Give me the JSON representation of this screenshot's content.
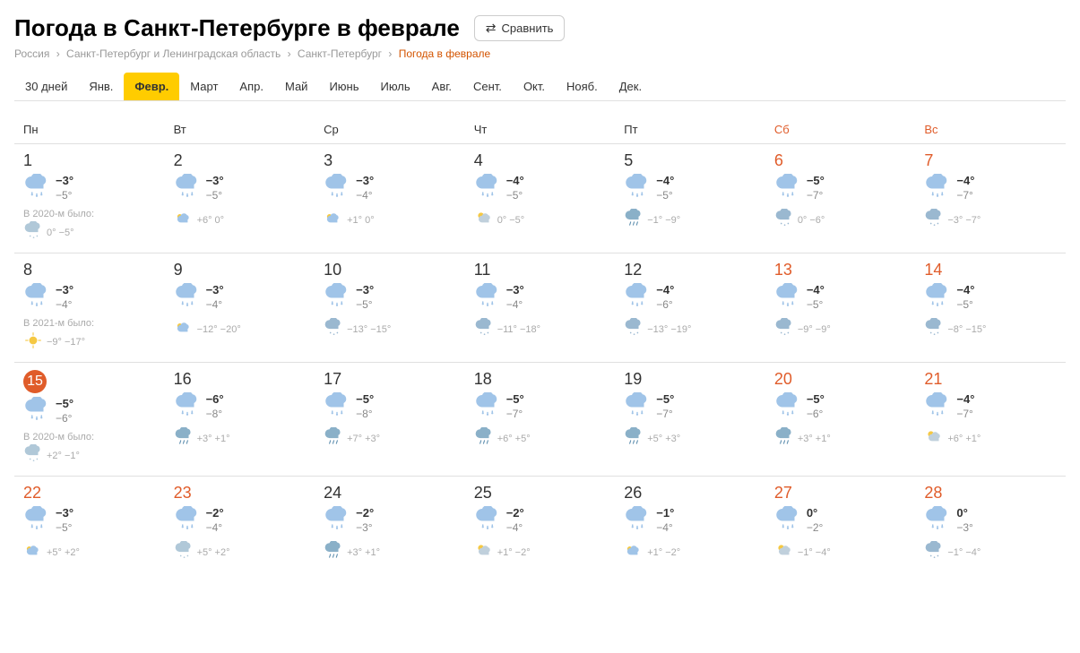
{
  "header": {
    "title": "Погода в Санкт-Петербурге в феврале",
    "compare_label": "Сравнить"
  },
  "breadcrumb": {
    "parts": [
      "Россия",
      "Санкт-Петербург и Ленинградская область",
      "Санкт-Петербург",
      "Погода в феврале"
    ]
  },
  "tabs": [
    {
      "label": "30 дней",
      "active": false
    },
    {
      "label": "Янв.",
      "active": false
    },
    {
      "label": "Февр.",
      "active": true
    },
    {
      "label": "Март",
      "active": false
    },
    {
      "label": "Апр.",
      "active": false
    },
    {
      "label": "Май",
      "active": false
    },
    {
      "label": "Июнь",
      "active": false
    },
    {
      "label": "Июль",
      "active": false
    },
    {
      "label": "Авг.",
      "active": false
    },
    {
      "label": "Сент.",
      "active": false
    },
    {
      "label": "Окт.",
      "active": false
    },
    {
      "label": "Нояб.",
      "active": false
    },
    {
      "label": "Дек.",
      "active": false
    }
  ],
  "weekdays": [
    {
      "label": "Пн",
      "weekend": false
    },
    {
      "label": "Вт",
      "weekend": false
    },
    {
      "label": "Ср",
      "weekend": false
    },
    {
      "label": "Чт",
      "weekend": false
    },
    {
      "label": "Пт",
      "weekend": false
    },
    {
      "label": "Сб",
      "weekend": true
    },
    {
      "label": "Вс",
      "weekend": true
    }
  ],
  "weeks": [
    {
      "days": [
        {
          "num": "1",
          "weekend": false,
          "today": false,
          "high": "−3°",
          "low": "−5°",
          "icon": "cloud-snow",
          "prev_label": "В 2020-м было:",
          "prev_icon": "cloud-snow-light",
          "prev_temps": "0° −5°"
        },
        {
          "num": "2",
          "weekend": false,
          "today": false,
          "high": "−3°",
          "low": "−5°",
          "icon": "cloud-snow",
          "prev_label": "",
          "prev_icon": "cloudy-sun",
          "prev_temps": "+6° 0°"
        },
        {
          "num": "3",
          "weekend": false,
          "today": false,
          "high": "−3°",
          "low": "−4°",
          "icon": "cloud-snow",
          "prev_label": "",
          "prev_icon": "cloudy-sun",
          "prev_temps": "+1° 0°"
        },
        {
          "num": "4",
          "weekend": false,
          "today": false,
          "high": "−4°",
          "low": "−5°",
          "icon": "cloud-snow",
          "prev_label": "",
          "prev_icon": "sun-cloudy",
          "prev_temps": "0° −5°"
        },
        {
          "num": "5",
          "weekend": false,
          "today": false,
          "high": "−4°",
          "low": "−5°",
          "icon": "cloud-snow",
          "prev_label": "",
          "prev_icon": "cloudy-rain",
          "prev_temps": "−1° −9°"
        },
        {
          "num": "6",
          "weekend": true,
          "today": false,
          "high": "−5°",
          "low": "−7°",
          "icon": "cloud-snow",
          "prev_label": "",
          "prev_icon": "cloudy-snow",
          "prev_temps": "0° −6°"
        },
        {
          "num": "7",
          "weekend": true,
          "today": false,
          "high": "−4°",
          "low": "−7°",
          "icon": "cloud-snow",
          "prev_label": "",
          "prev_icon": "cloudy-snow",
          "prev_temps": "−3° −7°"
        }
      ]
    },
    {
      "days": [
        {
          "num": "8",
          "weekend": false,
          "today": false,
          "high": "−3°",
          "low": "−4°",
          "icon": "cloud-snow",
          "prev_label": "В 2021-м было:",
          "prev_icon": "sun",
          "prev_temps": "−9° −17°"
        },
        {
          "num": "9",
          "weekend": false,
          "today": false,
          "high": "−3°",
          "low": "−4°",
          "icon": "cloud-snow",
          "prev_label": "",
          "prev_icon": "cloudy-sun",
          "prev_temps": "−12° −20°"
        },
        {
          "num": "10",
          "weekend": false,
          "today": false,
          "high": "−3°",
          "low": "−5°",
          "icon": "cloud-snow",
          "prev_label": "",
          "prev_icon": "cloudy-snow",
          "prev_temps": "−13° −15°"
        },
        {
          "num": "11",
          "weekend": false,
          "today": false,
          "high": "−3°",
          "low": "−4°",
          "icon": "cloud-snow",
          "prev_label": "",
          "prev_icon": "cloudy-snow",
          "prev_temps": "−11° −18°"
        },
        {
          "num": "12",
          "weekend": false,
          "today": false,
          "high": "−4°",
          "low": "−6°",
          "icon": "cloud-snow",
          "prev_label": "",
          "prev_icon": "cloudy-snow",
          "prev_temps": "−13° −19°"
        },
        {
          "num": "13",
          "weekend": true,
          "today": false,
          "high": "−4°",
          "low": "−5°",
          "icon": "cloud-snow",
          "prev_label": "",
          "prev_icon": "cloudy-snow",
          "prev_temps": "−9° −9°"
        },
        {
          "num": "14",
          "weekend": true,
          "today": false,
          "high": "−4°",
          "low": "−5°",
          "icon": "cloud-snow",
          "prev_label": "",
          "prev_icon": "cloudy-snow",
          "prev_temps": "−8° −15°"
        }
      ]
    },
    {
      "days": [
        {
          "num": "15",
          "weekend": false,
          "today": true,
          "high": "−5°",
          "low": "−6°",
          "icon": "cloud-snow",
          "prev_label": "В 2020-м было:",
          "prev_icon": "cloud-snow-light",
          "prev_temps": "+2° −1°"
        },
        {
          "num": "16",
          "weekend": false,
          "today": false,
          "high": "−6°",
          "low": "−8°",
          "icon": "cloud-snow",
          "prev_label": "",
          "prev_icon": "cloudy-rain",
          "prev_temps": "+3° +1°"
        },
        {
          "num": "17",
          "weekend": false,
          "today": false,
          "high": "−5°",
          "low": "−8°",
          "icon": "cloud-snow",
          "prev_label": "",
          "prev_icon": "cloudy-rain",
          "prev_temps": "+7° +3°"
        },
        {
          "num": "18",
          "weekend": false,
          "today": false,
          "high": "−5°",
          "low": "−7°",
          "icon": "cloud-snow",
          "prev_label": "",
          "prev_icon": "cloudy-rain",
          "prev_temps": "+6° +5°"
        },
        {
          "num": "19",
          "weekend": false,
          "today": false,
          "high": "−5°",
          "low": "−7°",
          "icon": "cloud-snow",
          "prev_label": "",
          "prev_icon": "cloudy-rain",
          "prev_temps": "+5° +3°"
        },
        {
          "num": "20",
          "weekend": true,
          "today": false,
          "high": "−5°",
          "low": "−6°",
          "icon": "cloud-snow",
          "prev_label": "",
          "prev_icon": "cloudy-rain",
          "prev_temps": "+3° +1°"
        },
        {
          "num": "21",
          "weekend": true,
          "today": false,
          "high": "−4°",
          "low": "−7°",
          "icon": "cloud-snow",
          "prev_label": "",
          "prev_icon": "sun-cloudy",
          "prev_temps": "+6° +1°"
        }
      ]
    },
    {
      "days": [
        {
          "num": "22",
          "weekend": true,
          "today": false,
          "high": "−3°",
          "low": "−5°",
          "icon": "cloud-snow",
          "prev_label": "",
          "prev_icon": "cloudy-sun",
          "prev_temps": "+5° +2°"
        },
        {
          "num": "23",
          "weekend": true,
          "today": false,
          "high": "−2°",
          "low": "−4°",
          "icon": "cloud-snow",
          "prev_label": "",
          "prev_icon": "cloud-snow-light",
          "prev_temps": "+5° +2°"
        },
        {
          "num": "24",
          "weekend": false,
          "today": false,
          "high": "−2°",
          "low": "−3°",
          "icon": "cloud-snow",
          "prev_label": "",
          "prev_icon": "cloudy-rain",
          "prev_temps": "+3° +1°"
        },
        {
          "num": "25",
          "weekend": false,
          "today": false,
          "high": "−2°",
          "low": "−4°",
          "icon": "cloud-snow",
          "prev_label": "",
          "prev_icon": "sun-cloudy",
          "prev_temps": "+1° −2°"
        },
        {
          "num": "26",
          "weekend": false,
          "today": false,
          "high": "−1°",
          "low": "−4°",
          "icon": "cloud-snow",
          "prev_label": "",
          "prev_icon": "cloudy-sun",
          "prev_temps": "+1° −2°"
        },
        {
          "num": "27",
          "weekend": true,
          "today": false,
          "high": "0°",
          "low": "−2°",
          "icon": "cloud-snow",
          "prev_label": "",
          "prev_icon": "sun-cloudy",
          "prev_temps": "−1° −4°"
        },
        {
          "num": "28",
          "weekend": true,
          "today": false,
          "high": "0°",
          "low": "−3°",
          "icon": "cloud-snow",
          "prev_label": "",
          "prev_icon": "cloudy-snow",
          "prev_temps": "−1° −4°"
        }
      ]
    }
  ]
}
